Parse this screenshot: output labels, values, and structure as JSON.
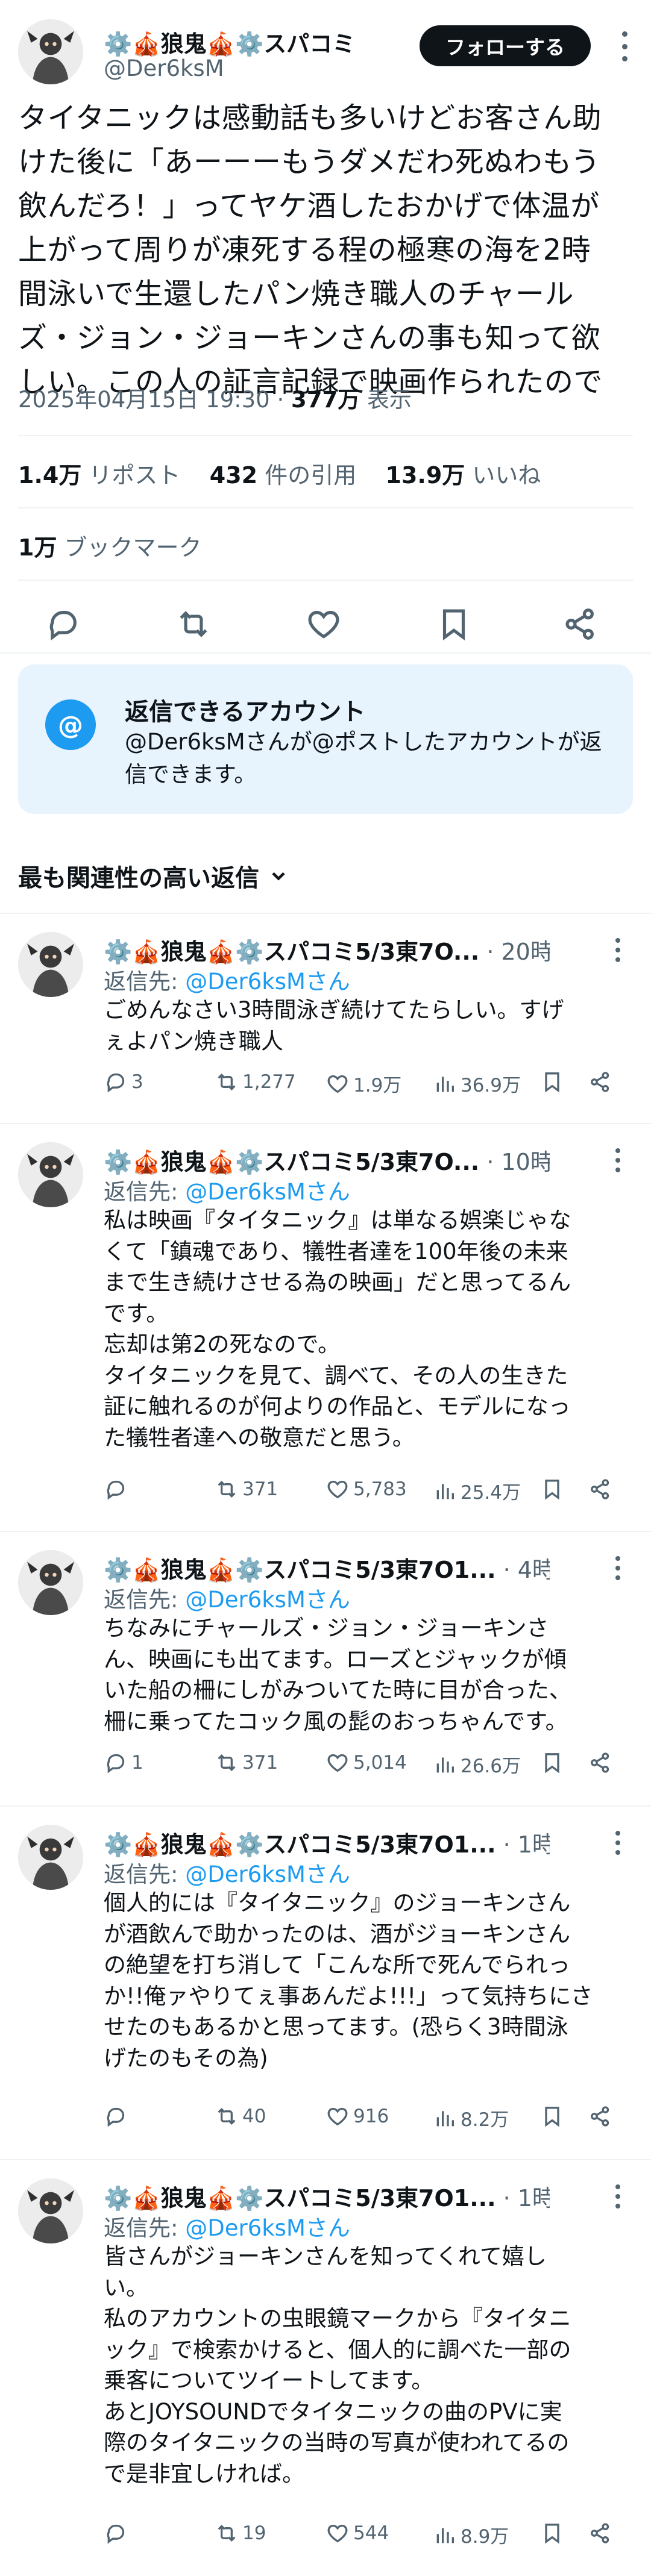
{
  "post": {
    "author_name": "⚙️🎪狼鬼🎪⚙️スパコミ",
    "author_handle": "@Der6ksM",
    "follow_label": "フォローする",
    "text": "タイタニックは感動話も多いけどお客さん助\nけた後に「あーーーもうダメだわ死ぬわもう\n飲んだろ！」ってヤケ酒したおかげで体温が\n上がって周りが凍死する程の極寒の海を2時\n間泳いで生還したパン焼き職人のチャール\nズ・ジョン・ジョーキンさんの事も知って欲\nしい。この人の証言記録で映画作られたので",
    "datetime": "2025年04月15日 19:30 · ",
    "views": "377万",
    "views_label": " 表示",
    "reposts": "1.4万",
    "reposts_label": "リポスト",
    "quotes": "432",
    "quotes_label": "件の引用",
    "likes": "13.9万",
    "likes_label": "いいね",
    "bookmarks": "1万",
    "bookmarks_label": "ブックマーク"
  },
  "reply_restriction": {
    "icon_glyph": "@",
    "title": "返信できるアカウント",
    "description": "@Der6ksMさんが@ポストしたアカウントが返信できます。"
  },
  "sort": {
    "label": "最も関連性の高い返信"
  },
  "replies": [
    {
      "name": "⚙️🎪狼鬼🎪⚙️スパコミ5/3東7O...",
      "time": " · 20時間",
      "reply_to_prefix": "返信先: ",
      "reply_to_handle": "@Der6ksMさん",
      "text": "ごめんなさい3時間泳ぎ続けてたらしい。すげ\nぇよパン焼き職人",
      "replies": "3",
      "reposts": "1,277",
      "likes": "1.9万",
      "views": "36.9万"
    },
    {
      "name": "⚙️🎪狼鬼🎪⚙️スパコミ5/3東7O...",
      "time": " · 10時間",
      "reply_to_prefix": "返信先: ",
      "reply_to_handle": "@Der6ksMさん",
      "text": "私は映画『タイタニック』は単なる娯楽じゃな\nくて「鎮魂であり、犠牲者達を100年後の未来\nまで生き続けさせる為の映画」だと思ってるん\nです。\n忘却は第2の死なので。\nタイタニックを見て、調べて、その人の生きた\n証に触れるのが何よりの作品と、モデルになっ\nた犠牲者達への敬意だと思う。",
      "replies": "",
      "reposts": "371",
      "likes": "5,783",
      "views": "25.4万"
    },
    {
      "name": "⚙️🎪狼鬼🎪⚙️スパコミ5/3東7O1...",
      "time": " · 4時間",
      "reply_to_prefix": "返信先: ",
      "reply_to_handle": "@Der6ksMさん",
      "text": "ちなみにチャールズ・ジョン・ジョーキンさ\nん、映画にも出てます。ローズとジャックが傾\nいた船の柵にしがみついてた時に目が合った、\n柵に乗ってたコック風の髭のおっちゃんです。",
      "replies": "1",
      "reposts": "371",
      "likes": "5,014",
      "views": "26.6万"
    },
    {
      "name": "⚙️🎪狼鬼🎪⚙️スパコミ5/3東7O1...",
      "time": " · 1時間",
      "reply_to_prefix": "返信先: ",
      "reply_to_handle": "@Der6ksMさん",
      "text": "個人的には『タイタニック』のジョーキンさん\nが酒飲んで助かったのは、酒がジョーキンさん\nの絶望を打ち消して「こんな所で死んでられっ\nか!!俺ァやりてぇ事あんだよ!!!」って気持ちにさ\nせたのもあるかと思ってます。(恐らく3時間泳\nげたのもその為)",
      "replies": "",
      "reposts": "40",
      "likes": "916",
      "views": "8.2万"
    },
    {
      "name": "⚙️🎪狼鬼🎪⚙️スパコミ5/3東7O1...",
      "time": " · 1時間",
      "reply_to_prefix": "返信先: ",
      "reply_to_handle": "@Der6ksMさん",
      "text": "皆さんがジョーキンさんを知ってくれて嬉し\nい。\n私のアカウントの虫眼鏡マークから『タイタニ\nック』で検索かけると、個人的に調べた一部の\n乗客についてツイートしてます。\nあとJOYSOUNDでタイタニックの曲のPVに実\n際のタイタニックの当時の写真が使われてるの\nで是非宜しければ。",
      "replies": "",
      "reposts": "19",
      "likes": "544",
      "views": "8.9万"
    }
  ],
  "colors": {
    "text": "#0f1419",
    "secondary": "#536471",
    "link": "#1d9bf0",
    "reply_box_bg": "#e7f3fd",
    "divider": "#eff3f4"
  }
}
